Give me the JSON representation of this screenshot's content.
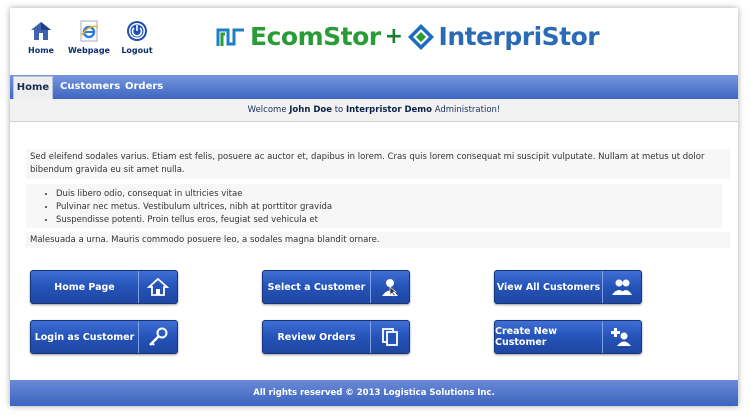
{
  "top_icons": [
    {
      "label": "Home",
      "icon": "house-icon"
    },
    {
      "label": "Webpage",
      "icon": "ie-browser-icon"
    },
    {
      "label": "Logout",
      "icon": "power-icon"
    }
  ],
  "logo": {
    "left": "EcomStor",
    "plus": "+",
    "right": "InterpriStor"
  },
  "nav": {
    "items": [
      "Home",
      "Customers",
      "Orders"
    ],
    "active": "Home"
  },
  "welcome": {
    "prefix": "Welcome",
    "user": "John Doe",
    "to": "to",
    "company": "Interpristor Demo",
    "suffix": "Administration!"
  },
  "content": {
    "paragraph1": "Sed eleifend sodales varius. Etiam est felis, posuere ac auctor et, dapibus in lorem. Cras quis lorem consequat mi suscipit vulputate. Nullam at metus ut dolor bibendum gravida eu sit amet nulla.",
    "bullets": [
      "Duis libero odio, consequat in ultricies vitae",
      "Pulvinar nec metus. Vestibulum ultrices, nibh at porttitor gravida",
      "Suspendisse potenti. Proin tellus eros, feugiat sed vehicula et"
    ],
    "paragraph2": "Malesuada a urna. Mauris commodo posuere leo, a sodales magna blandit ornare."
  },
  "buttons": [
    {
      "label": "Home Page",
      "icon": "house-icon"
    },
    {
      "label": "Select a Customer",
      "icon": "person-click-icon"
    },
    {
      "label": "View All Customers",
      "icon": "people-icon"
    },
    {
      "label": "Login as Customer",
      "icon": "key-icon"
    },
    {
      "label": "Review Orders",
      "icon": "documents-icon"
    },
    {
      "label": "Create New Customer",
      "icon": "add-person-icon"
    }
  ],
  "footer": {
    "text": "All rights reserved © 2013 Logistica Solutions Inc."
  }
}
